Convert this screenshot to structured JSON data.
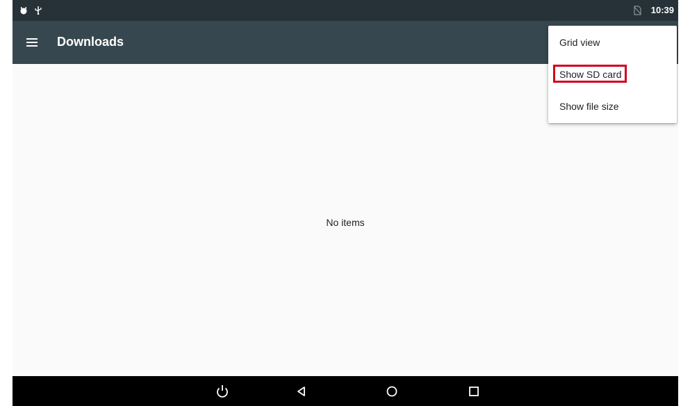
{
  "status_bar": {
    "time": "10:39",
    "icons_left": [
      "android-debug-icon",
      "usb-icon"
    ],
    "icons_right": [
      "no-sim-icon"
    ]
  },
  "app_bar": {
    "title": "Downloads",
    "menu_icon": "hamburger-menu-icon",
    "color": "#37474f"
  },
  "content": {
    "empty_message": "No items"
  },
  "overflow_menu": {
    "items": [
      {
        "label": "Grid view"
      },
      {
        "label": "Show SD card",
        "highlighted": true,
        "highlight_color": "#d0021b"
      },
      {
        "label": "Show file size"
      }
    ]
  },
  "nav_bar": {
    "buttons": [
      "power-icon",
      "back-icon",
      "home-icon",
      "recents-icon"
    ]
  }
}
